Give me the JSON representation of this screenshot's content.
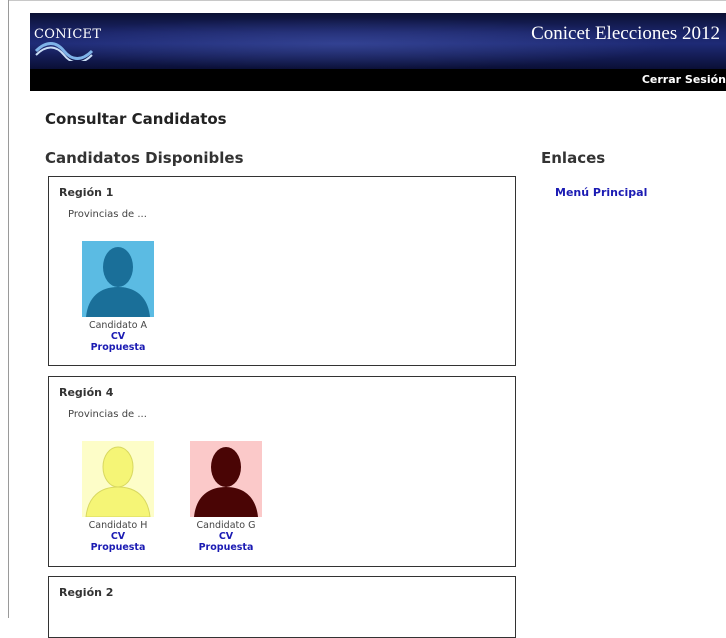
{
  "header": {
    "logo_text": "CONICET",
    "title": "Conicet Elecciones 2012",
    "logout_label": "Cerrar Sesión"
  },
  "page": {
    "title": "Consultar Candidatos",
    "section_title": "Candidatos Disponibles"
  },
  "links": {
    "title": "Enlaces",
    "items": [
      {
        "label": "Menú Principal"
      }
    ]
  },
  "regions": [
    {
      "name": "Región 1",
      "provinces": "Provincias de ...",
      "candidates": [
        {
          "name": "Candidato A",
          "cv_label": "CV",
          "proposal_label": "Propuesta",
          "bg_color": "#5bbbe3",
          "silhouette_color": "#1a6f99"
        }
      ]
    },
    {
      "name": "Región 4",
      "provinces": "Provincias de ...",
      "candidates": [
        {
          "name": "Candidato H",
          "cv_label": "CV",
          "proposal_label": "Propuesta",
          "bg_color": "#fdfdc8",
          "silhouette_color": "#f5f576"
        },
        {
          "name": "Candidato G",
          "cv_label": "CV",
          "proposal_label": "Propuesta",
          "bg_color": "#fbc9c9",
          "silhouette_color": "#4a0505"
        }
      ]
    },
    {
      "name": "Región 2",
      "provinces": "",
      "candidates": []
    }
  ],
  "colors": {
    "link": "#1b1bb3",
    "header_dark": "#0b1033",
    "header_mid": "#1e2a75"
  }
}
